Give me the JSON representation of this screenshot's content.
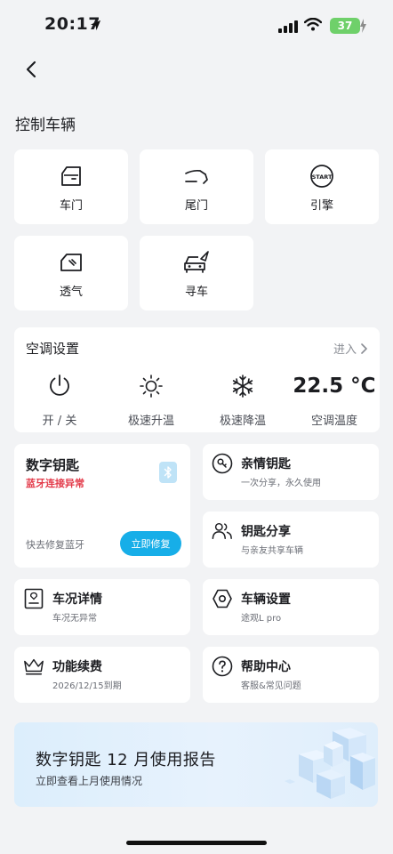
{
  "status_bar": {
    "time": "20:17",
    "battery": "37"
  },
  "control": {
    "title": "控制车辆",
    "items": [
      {
        "label": "车门",
        "icon": "car-door-icon"
      },
      {
        "label": "尾门",
        "icon": "tailgate-icon"
      },
      {
        "label": "引擎",
        "icon": "engine-start-icon"
      },
      {
        "label": "透气",
        "icon": "window-vent-icon"
      },
      {
        "label": "寻车",
        "icon": "find-car-icon"
      }
    ]
  },
  "ac": {
    "title": "空调设置",
    "enter": "进入",
    "power_label": "开 / 关",
    "heat_label": "极速升温",
    "cool_label": "极速降温",
    "temp_value": "22.5 °C",
    "temp_label": "空调温度"
  },
  "digital_key": {
    "title": "数字钥匙",
    "error": "蓝牙连接异常",
    "hint": "快去修复蓝牙",
    "fix_button": "立即修复"
  },
  "tiles": {
    "family_key": {
      "title": "亲情钥匙",
      "subtitle": "一次分享，永久使用"
    },
    "key_share": {
      "title": "钥匙分享",
      "subtitle": "与亲友共享车辆"
    },
    "vehicle_status": {
      "title": "车况详情",
      "subtitle": "车况无异常"
    },
    "vehicle_settings": {
      "title": "车辆设置",
      "subtitle": "途观L pro"
    },
    "renewal": {
      "title": "功能续费",
      "subtitle": "2026/12/15到期"
    },
    "help": {
      "title": "帮助中心",
      "subtitle": "客服&常见问题"
    }
  },
  "report": {
    "title": "数字钥匙 12 月使用报告",
    "subtitle": "立即查看上月使用情况"
  },
  "colors": {
    "accent": "#17aee8",
    "error": "#e33b4a",
    "background": "#f2f3f5"
  }
}
